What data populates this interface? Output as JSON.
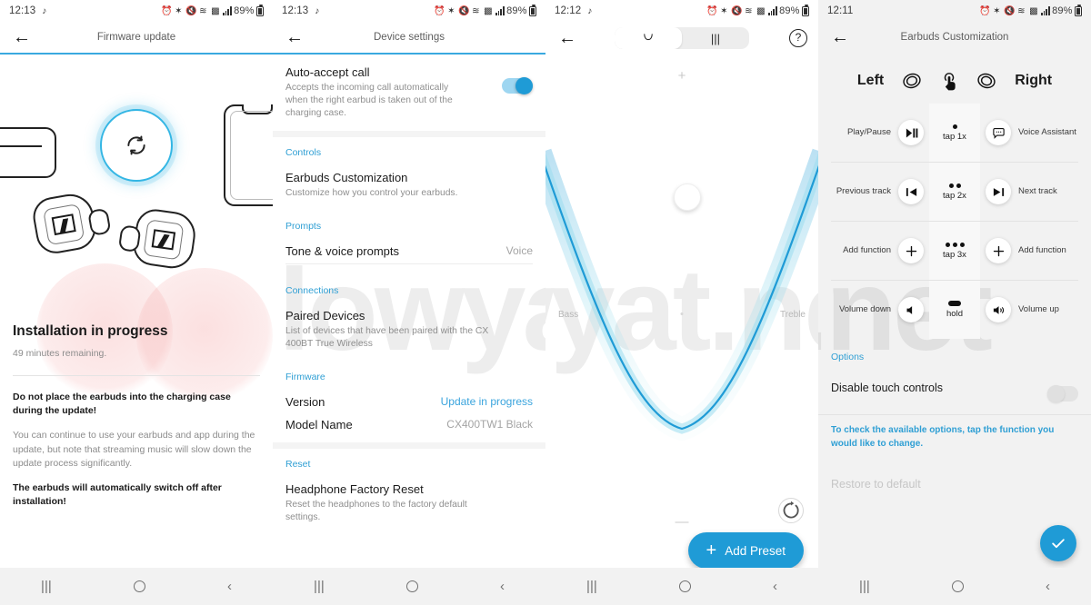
{
  "status_bar": {
    "time_1": "12:13",
    "time_2": "12:13",
    "time_3": "12:12",
    "time_4": "12:11",
    "music_note": "♪",
    "battery_text": "89%",
    "icons": [
      "alarm-icon",
      "bluetooth-icon",
      "mute-icon",
      "wifi-icon",
      "nfc-icon",
      "signal-icon"
    ]
  },
  "nav_bar": {
    "recents": "|||",
    "home": "home-circle",
    "back": "‹"
  },
  "screen1": {
    "title": "Firmware update",
    "back_label": "←",
    "heading": "Installation in progress",
    "subheading": "49 minutes remaining.",
    "warning_1": "Do not place the earbuds into the charging case during the update!",
    "body": "You can continue to use your earbuds and app during the update, but note that streaming music will slow down the update process significantly.",
    "warning_2": "The earbuds will automatically switch off after installation!",
    "accent": "#3aa9e0"
  },
  "screen2": {
    "title": "Device settings",
    "auto_accept": {
      "title": "Auto-accept call",
      "subtitle": "Accepts the incoming call automatically when the right earbud is taken out of the charging case.",
      "toggle_state": "on"
    },
    "sections": [
      {
        "label": "Controls",
        "rows": [
          {
            "title": "Earbuds Customization",
            "subtitle": "Customize how you control your earbuds.",
            "value": ""
          }
        ]
      },
      {
        "label": "Prompts",
        "rows": [
          {
            "title": "Tone & voice prompts",
            "subtitle": "",
            "value": "Voice"
          }
        ]
      },
      {
        "label": "Connections",
        "rows": [
          {
            "title": "Paired Devices",
            "subtitle": "List of devices that have been paired with the CX 400BT True Wireless",
            "value": ""
          }
        ]
      },
      {
        "label": "Firmware",
        "rows": [
          {
            "title": "Version",
            "subtitle": "",
            "value": "Update in progress",
            "value_blue": true
          },
          {
            "title": "Model Name",
            "subtitle": "",
            "value": "CX400TW1 Black"
          }
        ]
      },
      {
        "label": "Reset",
        "rows": [
          {
            "title": "Headphone Factory Reset",
            "subtitle": "Reset the headphones to the factory default settings.",
            "value": ""
          }
        ]
      }
    ]
  },
  "screen3": {
    "mode_curve": "curve-icon",
    "mode_bars": "|||",
    "help_label": "?",
    "plus_label": "+",
    "minus_label": "—",
    "add_preset_label": "Add Preset",
    "reset_label": "reset-icon",
    "accent": "#1f9bd6",
    "chart_data": {
      "type": "line",
      "title": "",
      "xlabel": "",
      "ylabel": "",
      "tick_labels": [
        "Bass",
        "Treble"
      ],
      "x": [
        0,
        10,
        20,
        30,
        40,
        50,
        60,
        70,
        80,
        90,
        100
      ],
      "values": [
        100,
        74,
        50,
        28,
        12,
        3,
        6,
        20,
        44,
        72,
        100
      ],
      "handle": {
        "x": 50,
        "y": 88
      },
      "ylim": [
        0,
        100
      ],
      "grid": false,
      "legend": "none"
    }
  },
  "screen4": {
    "title": "Earbuds Customization",
    "left_label": "Left",
    "right_label": "Right",
    "left_icon": "earbud-icon",
    "right_icon": "earbud-icon",
    "center_icon": "touch-tap-icon",
    "rows": [
      {
        "left": "Play/Pause",
        "left_icon": "play-pause-icon",
        "gesture": "tap 1x",
        "dots": 1,
        "right": "Voice Assistant",
        "right_icon": "voice-assistant-icon"
      },
      {
        "left": "Previous track",
        "left_icon": "previous-track-icon",
        "gesture": "tap 2x",
        "dots": 2,
        "right": "Next track",
        "right_icon": "next-track-icon"
      },
      {
        "left": "Add function",
        "left_icon": "plus-icon",
        "gesture": "tap 3x",
        "dots": 3,
        "right": "Add function",
        "right_icon": "plus-icon"
      },
      {
        "left": "Volume down",
        "left_icon": "volume-down-icon",
        "gesture": "hold",
        "dots": 0,
        "right": "Volume up",
        "right_icon": "volume-up-icon"
      }
    ],
    "options_label": "Options",
    "disable_touch_label": "Disable touch controls",
    "disable_touch_state": "off",
    "hint": "To check the available options, tap the function you would like to change.",
    "restore_label": "Restore to default",
    "confirm_icon": "check-icon",
    "accent": "#1f9bd6"
  },
  "watermark": {
    "text": "lowyat.net"
  }
}
